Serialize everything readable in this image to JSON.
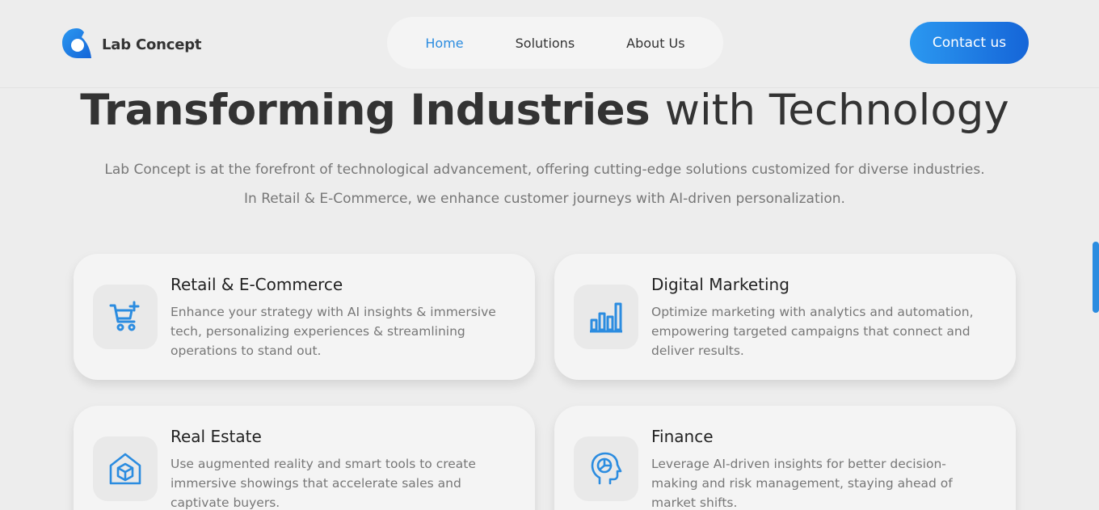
{
  "brand": {
    "name": "Lab Concept"
  },
  "nav": {
    "items": [
      {
        "label": "Home",
        "active": true
      },
      {
        "label": "Solutions"
      },
      {
        "label": "About Us"
      }
    ]
  },
  "header": {
    "cta_label": "Contact us"
  },
  "hero": {
    "title_bold": "Transforming Industries",
    "title_light": "with Technology",
    "line1": "Lab Concept is at the forefront of technological advancement, offering cutting-edge solutions customized for diverse industries.",
    "line2": "In Retail & E-Commerce, we enhance customer journeys with AI-driven personalization."
  },
  "cards": [
    {
      "icon": "cart-plus-icon",
      "title": "Retail & E-Commerce",
      "text": "Enhance your strategy with AI insights & immersive tech, personalizing experiences & streamlining operations to stand out."
    },
    {
      "icon": "bar-chart-icon",
      "title": "Digital Marketing",
      "text": "Optimize marketing with analytics and automation, empowering targeted campaigns that connect and deliver results."
    },
    {
      "icon": "house-cube-icon",
      "title": "Real Estate",
      "text": "Use augmented reality and smart tools to create immersive showings that accelerate sales and captivate buyers."
    },
    {
      "icon": "head-chart-icon",
      "title": "Finance",
      "text": "Leverage AI-driven insights for better decision-making and risk management, staying ahead of market shifts."
    }
  ],
  "colors": {
    "accent": "#2b8ce0",
    "background": "#ededed",
    "card": "#f4f4f4"
  }
}
